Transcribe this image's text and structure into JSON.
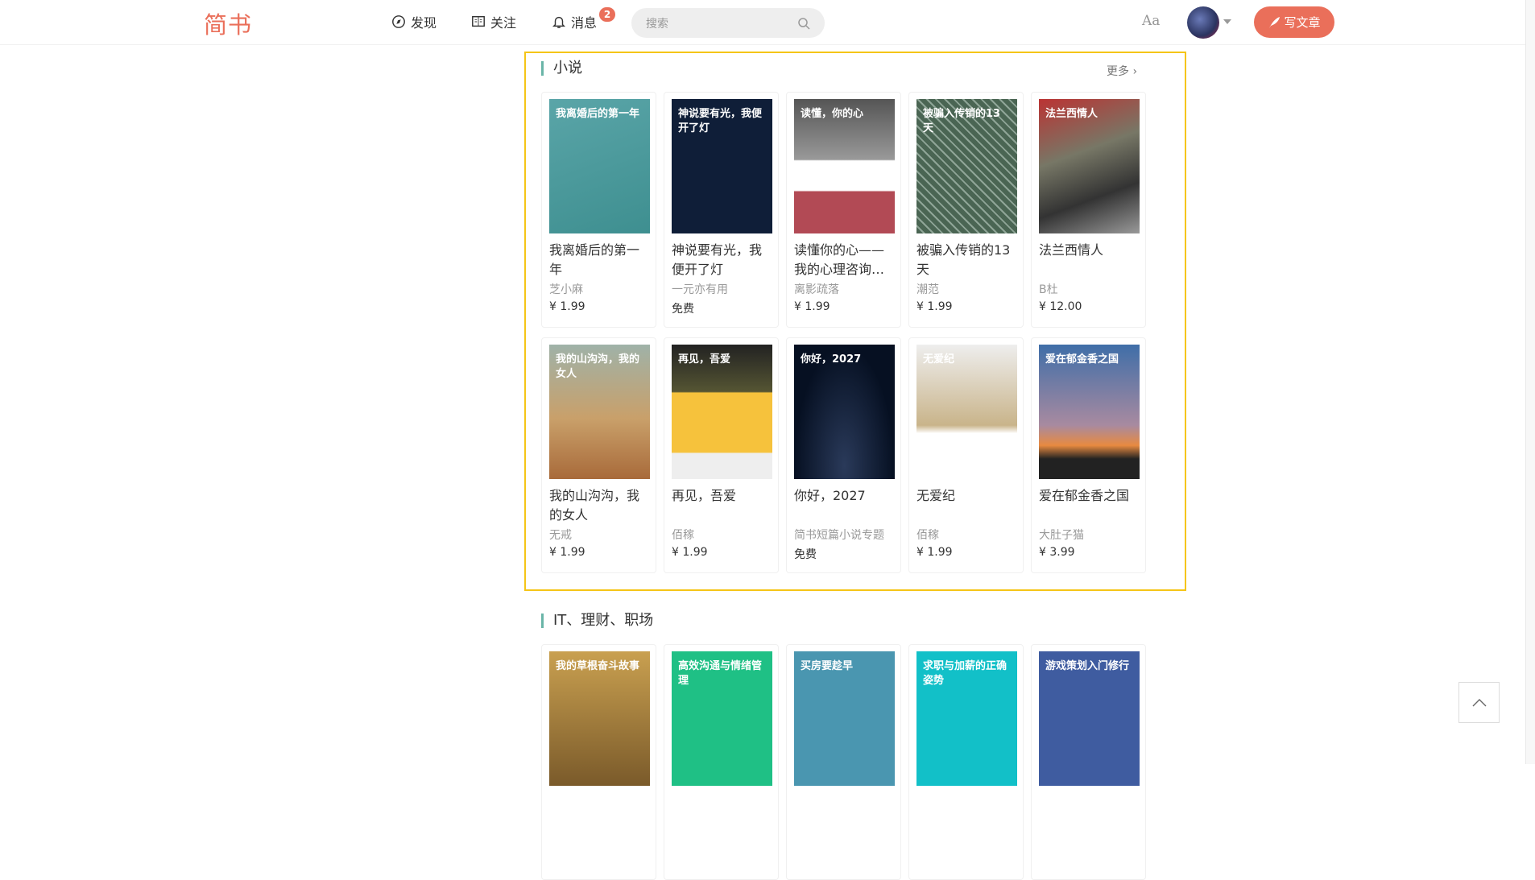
{
  "header": {
    "logo": "简书",
    "nav": [
      {
        "label": "发现",
        "icon": "compass-icon"
      },
      {
        "label": "关注",
        "icon": "book-icon"
      },
      {
        "label": "消息",
        "icon": "bell-icon"
      }
    ],
    "badge": "2",
    "search_placeholder": "搜索",
    "font_toggle": "Aa",
    "write_label": "写文章"
  },
  "sections": [
    {
      "title": "小说",
      "more": "更多",
      "books": [
        {
          "title": "我离婚后的第一年",
          "author": "芝小麻",
          "price": "¥ 1.99",
          "cover_text": "我离婚后的第一年",
          "bg": "linear-gradient(160deg,#5aa5a8,#3e8f90)"
        },
        {
          "title": "神说要有光，我便开了灯",
          "author": "一元亦有用",
          "price": "免费",
          "cover_text": "神说要有光，我便开了灯",
          "bg": "#0f1e38"
        },
        {
          "title": "读懂你的心——我的心理咨询…",
          "author": "离影疏落",
          "price": "¥ 1.99",
          "cover_text": "读懂，你的心",
          "bg": "linear-gradient(180deg,#555 0%,#999 45%,#fff 46%,#fff 68%,#b24a55 69%)"
        },
        {
          "title": "被骗入传销的13天",
          "author": "潮范",
          "price": "¥ 1.99",
          "cover_text": "被骗入传销的13天",
          "bg": "repeating-linear-gradient(45deg,#4a6553 0 6px,#8fa597 6px 8px)"
        },
        {
          "title": "法兰西情人",
          "author": "B杜",
          "price": "¥ 12.00",
          "cover_text": "法兰西情人",
          "bg": "linear-gradient(160deg,#b33,#776 40%,#333 70%,#999)"
        }
      ]
    },
    {
      "books": [
        {
          "title": "我的山沟沟，我的女人",
          "author": "无戒",
          "price": "¥ 1.99",
          "cover_text": "我的山沟沟，我的女人",
          "bg": "linear-gradient(180deg,#9fb2a8,#c9a06a 55%,#a86a3a)"
        },
        {
          "title": "再见，吾爱",
          "author": "佰稼",
          "price": "¥ 1.99",
          "cover_text": "再见，吾爱",
          "bg": "linear-gradient(180deg,#222 0%,#553 35%,#f6c23c 36%,#f6c23c 80%,#eee 81%)"
        },
        {
          "title": "你好，2027",
          "author": "简书短篇小说专题",
          "price": "免费",
          "cover_text": "你好，2027",
          "bg": "radial-gradient(ellipse at 50% 90%,#2a3a5a,#061022 70%)"
        },
        {
          "title": "无爱纪",
          "author": "佰稼",
          "price": "¥ 1.99",
          "cover_text": "无爱纪",
          "bg": "linear-gradient(180deg,#eee,#c9b48a 60%,#fff 66%)"
        },
        {
          "title": "爱在郁金香之国",
          "author": "大肚子猫",
          "price": "¥ 3.99",
          "cover_text": "爱在郁金香之国",
          "bg": "linear-gradient(180deg,#3f6ea8,#a88aa0 60%,#e88a40 75%,#222 85%)"
        }
      ]
    },
    {
      "title": "IT、理财、职场",
      "books": [
        {
          "cover_text": "我的草根奋斗故事",
          "bg": "linear-gradient(180deg,#c9a050,#7a5a2a)"
        },
        {
          "cover_text": "高效沟通与情绪管理",
          "bg": "#1fc085"
        },
        {
          "cover_text": "买房要趁早",
          "bg": "#4a96b0"
        },
        {
          "cover_text": "求职与加薪的正确姿势",
          "bg": "#12c0c8"
        },
        {
          "cover_text": "游戏策划入门修行",
          "bg": "#3f5ca0"
        }
      ]
    }
  ]
}
